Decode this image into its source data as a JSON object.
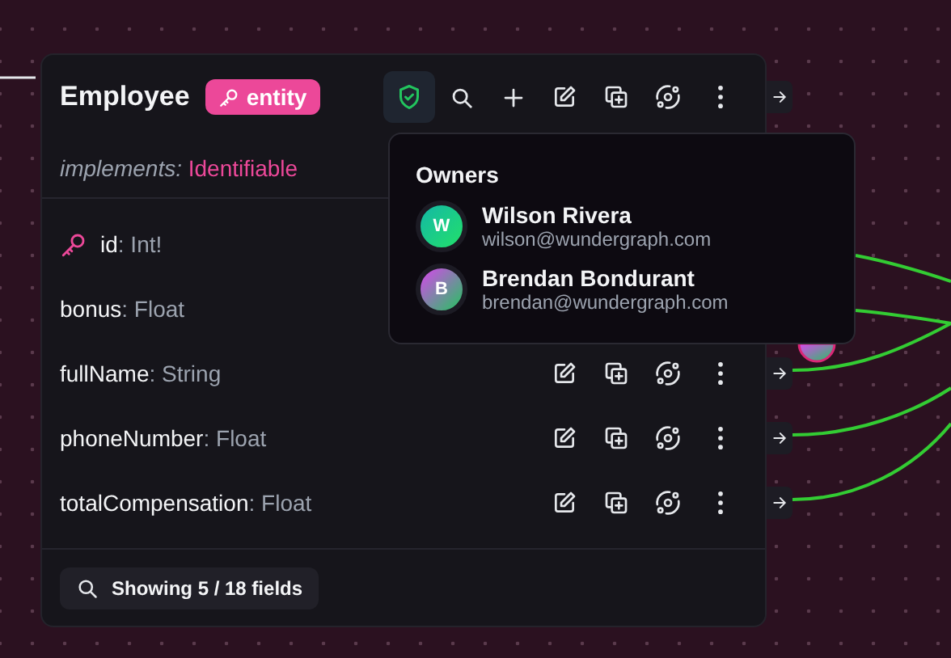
{
  "type_card": {
    "title": "Employee",
    "badge": "entity",
    "implements_label": "implements:",
    "implements_value": "Identifiable",
    "fields": [
      {
        "name": "id",
        "type": ": Int!",
        "key": true
      },
      {
        "name": "bonus",
        "type": ": Float",
        "key": false
      },
      {
        "name": "fullName",
        "type": ": String",
        "key": false,
        "actions_shown": true,
        "port": true
      },
      {
        "name": "phoneNumber",
        "type": ": Float",
        "key": false,
        "actions_shown": true,
        "port": true
      },
      {
        "name": "totalCompensation",
        "type": ": Float",
        "key": false,
        "actions_shown": true,
        "port": true
      }
    ],
    "footer": "Showing 5 / 18 fields"
  },
  "owners_popover": {
    "title": "Owners",
    "owners": [
      {
        "initial": "W",
        "name": "Wilson Rivera",
        "email": "wilson@wundergraph.com"
      },
      {
        "initial": "B",
        "name": "Brendan Bondurant",
        "email": "brendan@wundergraph.com"
      }
    ]
  }
}
